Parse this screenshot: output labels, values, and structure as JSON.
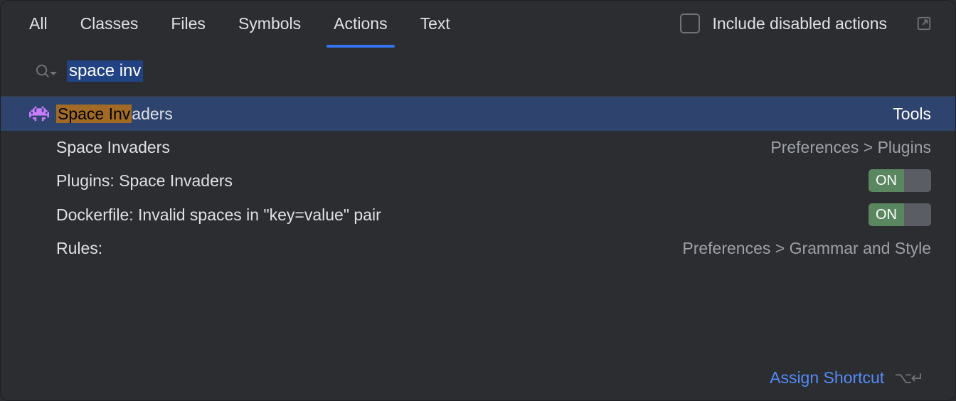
{
  "tabs": {
    "all": "All",
    "classes": "Classes",
    "files": "Files",
    "symbols": "Symbols",
    "actions": "Actions",
    "text": "Text"
  },
  "checkbox_label": "Include disabled actions",
  "search": {
    "query": "space inv"
  },
  "results": [
    {
      "label": "Space Invaders",
      "highlight": "Space Inv",
      "rest": "aders",
      "right": "Tools",
      "right_style": "white",
      "selected": true,
      "has_icon": true
    },
    {
      "label": "Space Invaders",
      "right": "Preferences > Plugins",
      "has_icon": false
    },
    {
      "label": "Plugins: Space Invaders",
      "toggle": "ON",
      "has_icon": false
    },
    {
      "label": "Dockerfile: Invalid spaces in \"key=value\" pair",
      "toggle": "ON",
      "has_icon": false
    },
    {
      "label": "Rules:",
      "right": "Preferences > Grammar and Style",
      "has_icon": false
    }
  ],
  "footer": {
    "assign": "Assign Shortcut"
  }
}
